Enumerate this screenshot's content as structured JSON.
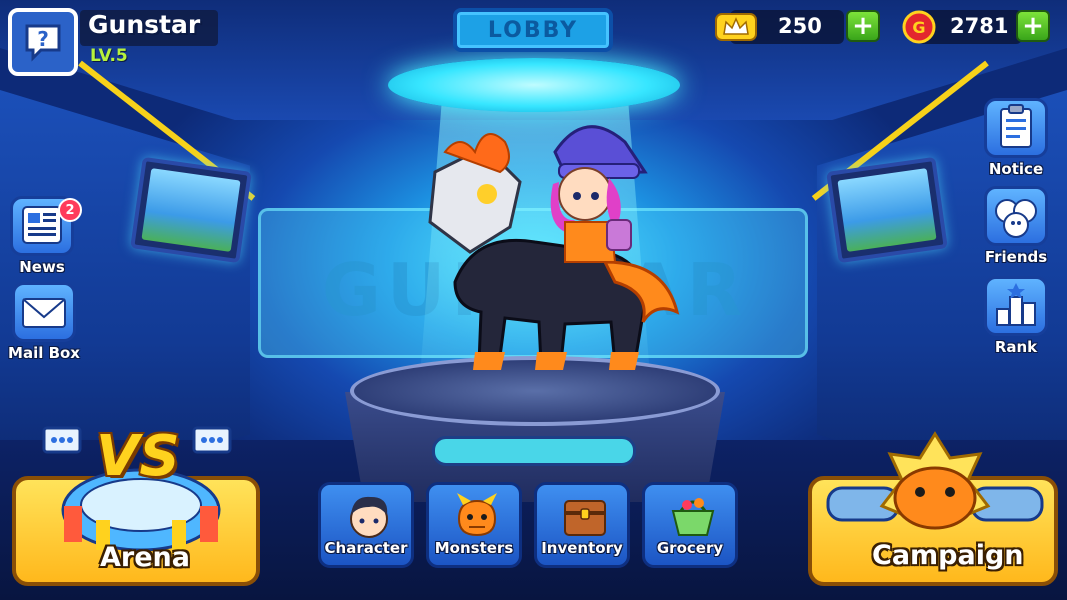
{
  "lobby": {
    "title": "LOBBY",
    "backdrop_text": "GUNSTAR"
  },
  "player": {
    "name": "Gunstar",
    "level": "LV.5"
  },
  "currency": {
    "crowns": {
      "icon": "crown-ticket-icon",
      "value": "250"
    },
    "gold": {
      "icon": "gold-coin-icon",
      "symbol": "G",
      "value": "2781"
    }
  },
  "left_menu": {
    "news": {
      "label": "News",
      "icon": "newspaper-icon",
      "badge": "2"
    },
    "mailbox": {
      "label": "Mail Box",
      "icon": "envelope-icon"
    }
  },
  "right_menu": {
    "notice": {
      "label": "Notice",
      "icon": "clipboard-icon"
    },
    "friends": {
      "label": "Friends",
      "icon": "friends-icon"
    },
    "rank": {
      "label": "Rank",
      "icon": "rank-icon"
    }
  },
  "bottom_menu": [
    {
      "label": "Character",
      "icon": "character-icon"
    },
    {
      "label": "Monsters",
      "icon": "dragon-icon"
    },
    {
      "label": "Inventory",
      "icon": "chest-icon"
    },
    {
      "label": "Grocery",
      "icon": "basket-icon"
    }
  ],
  "arena": {
    "label": "Arena",
    "badge_text": "VS"
  },
  "campaign": {
    "label": "Campaign"
  },
  "colors": {
    "accent_yellow": "#ffb81c",
    "button_blue": "#2c6fe0",
    "plus_green": "#39a51a",
    "badge_red": "#ff3b5c",
    "level_green": "#b6f23c"
  }
}
